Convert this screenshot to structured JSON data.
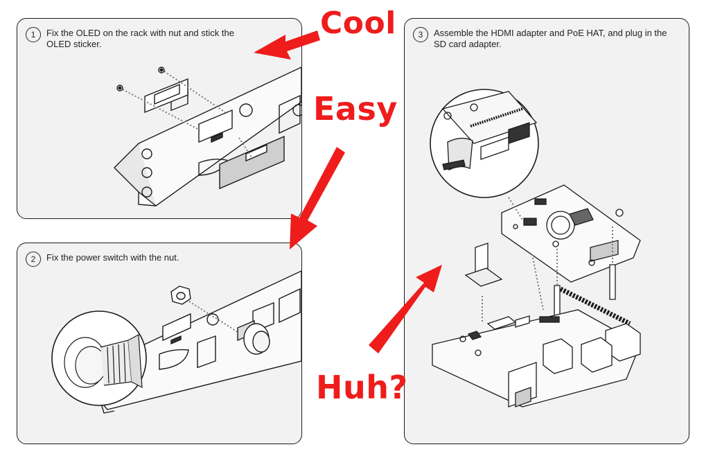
{
  "steps": [
    {
      "number": "1",
      "text": "Fix the OLED on the rack with nut and stick the OLED sticker."
    },
    {
      "number": "2",
      "text": "Fix the power switch with the nut."
    },
    {
      "number": "3",
      "text": "Assemble the HDMI adapter and PoE HAT, and plug in the SD card adapter."
    }
  ],
  "annotations": {
    "cool": "Cool",
    "easy": "Easy",
    "huh": "Huh?"
  },
  "colors": {
    "annotation": "#ef1c1c",
    "panel_bg": "#f2f2f2",
    "line": "#1a1a1a"
  }
}
